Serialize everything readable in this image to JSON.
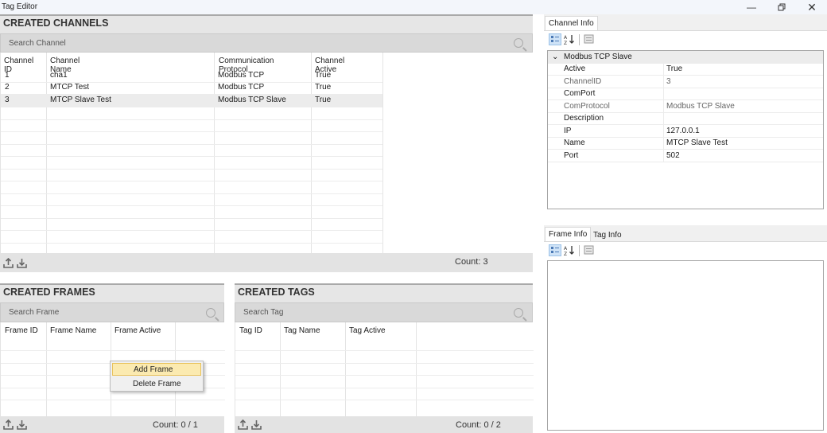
{
  "window": {
    "title": "Tag Editor"
  },
  "channels": {
    "title": "CREATED CHANNELS",
    "search_placeholder": "Search Channel",
    "columns": [
      "Channel ID",
      "Channel Name",
      "Communication Protocol",
      "Channel Active"
    ],
    "rows": [
      [
        "1",
        "cha1",
        "Modbus TCP",
        "True"
      ],
      [
        "2",
        "MTCP Test",
        "Modbus TCP",
        "True"
      ],
      [
        "3",
        "MTCP Slave Test",
        "Modbus TCP Slave",
        "True"
      ]
    ],
    "count": "Count: 3"
  },
  "frames": {
    "title": "CREATED FRAMES",
    "search_placeholder": "Search Frame",
    "columns": [
      "Frame ID",
      "Frame Name",
      "Frame Active"
    ],
    "count": "Count: 0 / 1"
  },
  "tags": {
    "title": "CREATED TAGS",
    "search_placeholder": "Search Tag",
    "columns": [
      "Tag ID",
      "Tag Name",
      "Tag Active"
    ],
    "count": "Count: 0 / 2"
  },
  "context_menu": {
    "items": [
      "Add Frame",
      "Delete Frame"
    ]
  },
  "channel_info": {
    "tab": "Channel Info",
    "group": "Modbus TCP Slave",
    "props": [
      {
        "key": "Active",
        "value": "True",
        "readonly": false
      },
      {
        "key": "ChannelID",
        "value": "3",
        "readonly": true
      },
      {
        "key": "ComPort",
        "value": "",
        "readonly": false
      },
      {
        "key": "ComProtocol",
        "value": "Modbus TCP Slave",
        "readonly": true
      },
      {
        "key": "Description",
        "value": "",
        "readonly": false
      },
      {
        "key": "IP",
        "value": "127.0.0.1",
        "readonly": false
      },
      {
        "key": "Name",
        "value": "MTCP Slave Test",
        "readonly": false
      },
      {
        "key": "Port",
        "value": "502",
        "readonly": false
      }
    ]
  },
  "lower_info": {
    "tabs": [
      "Frame Info",
      "Tag Info"
    ]
  }
}
